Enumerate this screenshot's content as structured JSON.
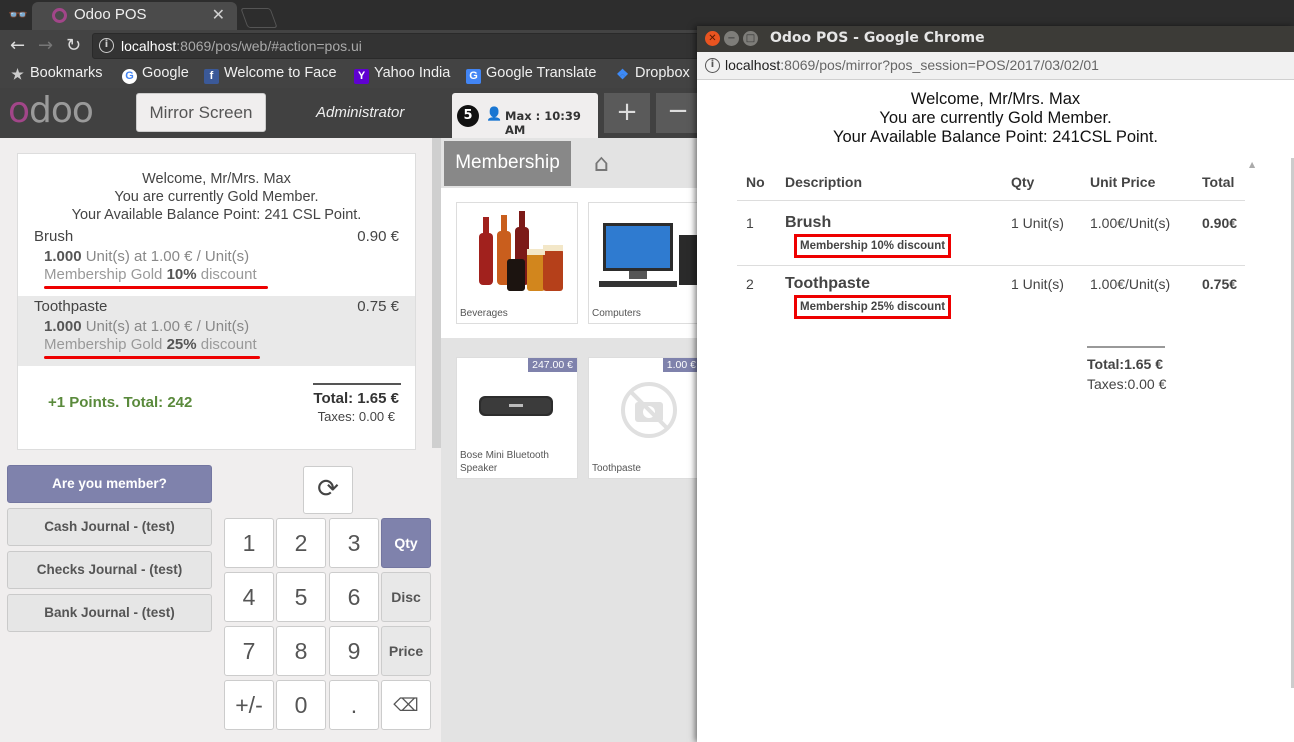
{
  "browser": {
    "tab_title": "Odoo POS",
    "url_host": "localhost",
    "url_rest": ":8069/pos/web/#action=pos.ui",
    "bookmarks": [
      {
        "label": "Bookmarks",
        "icon": "star-icon"
      },
      {
        "label": "Google",
        "icon": "google-icon"
      },
      {
        "label": "Welcome to Face",
        "icon": "facebook-icon"
      },
      {
        "label": "Yahoo India",
        "icon": "yahoo-icon"
      },
      {
        "label": "Google Translate",
        "icon": "translate-icon"
      },
      {
        "label": "Dropbox",
        "icon": "dropbox-icon"
      }
    ]
  },
  "pos": {
    "logo": "odoo",
    "mirror_button": "Mirror Screen",
    "user": "Administrator",
    "order_number": "5",
    "order_label": "Max : 10:39 AM",
    "add_order": "+",
    "remove_order": "−",
    "welcome": [
      "Welcome, Mr/Mrs. Max",
      "You are currently Gold Member.",
      "Your Available Balance Point: 241 CSL Point."
    ],
    "lines": [
      {
        "name": "Brush",
        "price": "0.90 €",
        "qty": "1.000",
        "qty_rest": " Unit(s) at 1.00 € / Unit(s)",
        "disc_pre": "Membership Gold ",
        "disc_pct": "10%",
        "disc_post": " discount"
      },
      {
        "name": "Toothpaste",
        "price": "0.75 €",
        "qty": "1.000",
        "qty_rest": " Unit(s) at 1.00 € / Unit(s)",
        "disc_pre": "Membership Gold ",
        "disc_pct": "25%",
        "disc_post": " discount"
      }
    ],
    "points": "+1 Points. Total: 242",
    "total": "Total: 1.65 €",
    "taxes": "Taxes: 0.00 €",
    "buttons": [
      "Are you member?",
      "Cash Journal - (test)",
      "Checks Journal - (test)",
      "Bank Journal - (test)"
    ],
    "keypad": [
      [
        "1",
        "2",
        "3",
        "Qty"
      ],
      [
        "4",
        "5",
        "6",
        "Disc"
      ],
      [
        "7",
        "8",
        "9",
        "Price"
      ],
      [
        "+/-",
        "0",
        ".",
        "⌫"
      ]
    ],
    "selected_mode": "Qty",
    "category": "Membership",
    "categories": [
      "Beverages",
      "Computers"
    ],
    "products": [
      {
        "name": "Bose Mini Bluetooth Speaker",
        "price": "247.00 €"
      },
      {
        "name": "Toothpaste",
        "price": "1.00 €"
      }
    ]
  },
  "mirror": {
    "window_title": "Odoo POS - Google Chrome",
    "url_host": "localhost",
    "url_rest": ":8069/pos/mirror?pos_session=POS/2017/03/02/01",
    "welcome": [
      "Welcome, Mr/Mrs. Max",
      "You are currently Gold Member.",
      "Your Available Balance Point: 241CSL Point."
    ],
    "headers": [
      "No",
      "Description",
      "Qty",
      "Unit Price",
      "Total"
    ],
    "rows": [
      {
        "no": "1",
        "desc": "Brush",
        "badge": "Membership 10% discount",
        "qty": "1 Unit(s)",
        "unit": "1.00€/Unit(s)",
        "total": "0.90€"
      },
      {
        "no": "2",
        "desc": "Toothpaste",
        "badge": "Membership 25% discount",
        "qty": "1 Unit(s)",
        "unit": "1.00€/Unit(s)",
        "total": "0.75€"
      }
    ],
    "total": "Total:1.65 €",
    "taxes": "Taxes:0.00 €"
  }
}
